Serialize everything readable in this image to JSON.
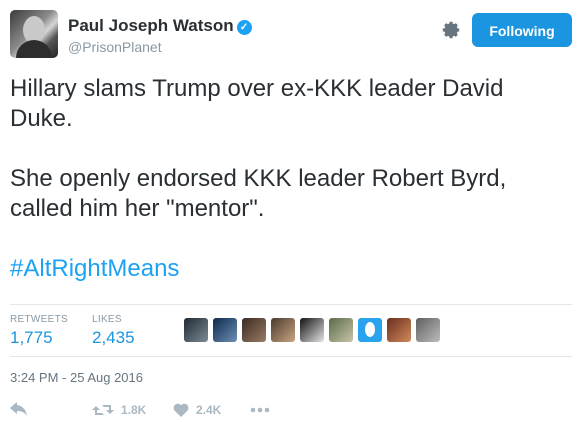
{
  "author": {
    "name": "Paul Joseph Watson",
    "handle": "@PrisonPlanet"
  },
  "follow_button_label": "Following",
  "tweet": {
    "paragraph1": "Hillary slams Trump over ex-KKK leader David Duke.",
    "paragraph2": "She openly endorsed KKK leader Robert Byrd, called him her \"mentor\".",
    "hashtag": "#AltRightMeans"
  },
  "stats": {
    "retweets_label": "RETWEETS",
    "retweets_value": "1,775",
    "likes_label": "LIKES",
    "likes_value": "2,435"
  },
  "timestamp": "3:24 PM - 25 Aug 2016",
  "actions": {
    "reply_icon": "reply-icon",
    "retweet_count": "1.8K",
    "like_count": "2.4K",
    "more_icon": "more-icon"
  },
  "colors": {
    "accent": "#1da1f2",
    "button": "#1b95e0",
    "muted": "#8899a6"
  }
}
